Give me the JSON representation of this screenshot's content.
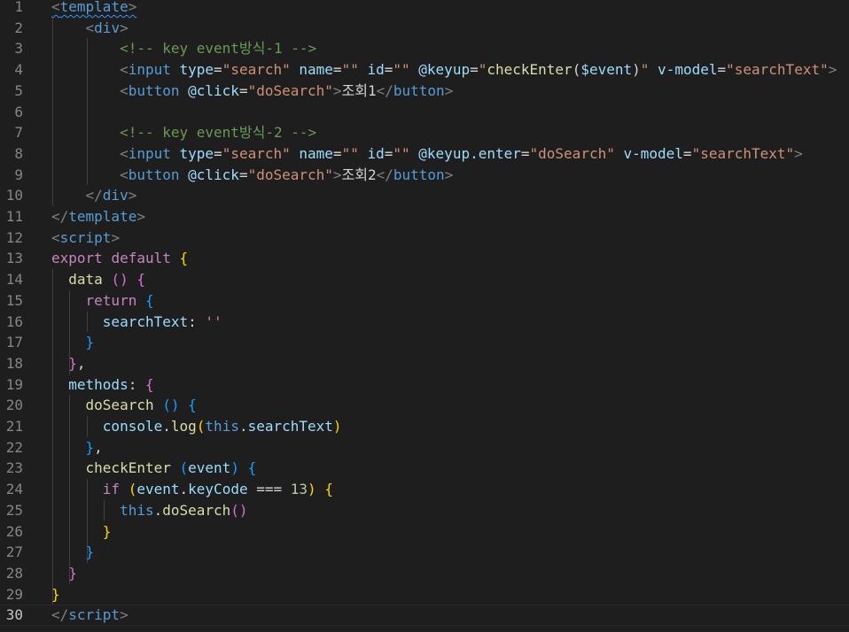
{
  "colors": {
    "background": "#1e1e1e",
    "line_number": "#858585",
    "line_number_active": "#c6c6c6",
    "tag_bracket": "#808080",
    "tag": "#569cd6",
    "attribute": "#9cdcfe",
    "string": "#ce9178",
    "comment": "#6a9955",
    "keyword_control": "#c586c0",
    "keyword": "#569cd6",
    "function": "#dcdcaa",
    "property": "#9cdcfe",
    "number": "#b5cea8",
    "plain": "#d4d4d4",
    "bracket_gold": "#ffd700",
    "bracket_purple": "#da70d6",
    "bracket_blue": "#179fff"
  },
  "editor": {
    "active_line": 30,
    "lines": [
      {
        "number": "1",
        "tokens": [
          {
            "t": "<",
            "c": "tag_bracket",
            "sq": true
          },
          {
            "t": "template",
            "c": "tag",
            "sq": true
          },
          {
            "t": ">",
            "c": "tag_bracket",
            "sq": true
          }
        ]
      },
      {
        "number": "2",
        "tokens": [
          {
            "t": "    ",
            "c": "plain"
          },
          {
            "t": "<",
            "c": "tag_bracket"
          },
          {
            "t": "div",
            "c": "tag"
          },
          {
            "t": ">",
            "c": "tag_bracket"
          }
        ]
      },
      {
        "number": "3",
        "tokens": [
          {
            "t": "        ",
            "c": "plain"
          },
          {
            "t": "<!-- key event방식-1 -->",
            "c": "comment"
          }
        ]
      },
      {
        "number": "4",
        "tokens": [
          {
            "t": "        ",
            "c": "plain"
          },
          {
            "t": "<",
            "c": "tag_bracket"
          },
          {
            "t": "input",
            "c": "tag"
          },
          {
            "t": " ",
            "c": "plain"
          },
          {
            "t": "type",
            "c": "attribute"
          },
          {
            "t": "=",
            "c": "plain"
          },
          {
            "t": "\"search\"",
            "c": "string"
          },
          {
            "t": " ",
            "c": "plain"
          },
          {
            "t": "name",
            "c": "attribute"
          },
          {
            "t": "=",
            "c": "plain"
          },
          {
            "t": "\"\"",
            "c": "string"
          },
          {
            "t": " ",
            "c": "plain"
          },
          {
            "t": "id",
            "c": "attribute"
          },
          {
            "t": "=",
            "c": "plain"
          },
          {
            "t": "\"\"",
            "c": "string"
          },
          {
            "t": " ",
            "c": "plain"
          },
          {
            "t": "@keyup",
            "c": "attribute"
          },
          {
            "t": "=",
            "c": "plain"
          },
          {
            "t": "\"",
            "c": "string"
          },
          {
            "t": "checkEnter",
            "c": "function"
          },
          {
            "t": "(",
            "c": "plain"
          },
          {
            "t": "$event",
            "c": "property"
          },
          {
            "t": ")",
            "c": "plain"
          },
          {
            "t": "\"",
            "c": "string"
          },
          {
            "t": " ",
            "c": "plain"
          },
          {
            "t": "v-model",
            "c": "attribute"
          },
          {
            "t": "=",
            "c": "plain"
          },
          {
            "t": "\"searchText\"",
            "c": "string"
          },
          {
            "t": ">",
            "c": "tag_bracket"
          }
        ]
      },
      {
        "number": "5",
        "tokens": [
          {
            "t": "        ",
            "c": "plain"
          },
          {
            "t": "<",
            "c": "tag_bracket"
          },
          {
            "t": "button",
            "c": "tag"
          },
          {
            "t": " ",
            "c": "plain"
          },
          {
            "t": "@click",
            "c": "attribute"
          },
          {
            "t": "=",
            "c": "plain"
          },
          {
            "t": "\"doSearch\"",
            "c": "string"
          },
          {
            "t": ">",
            "c": "tag_bracket"
          },
          {
            "t": "조회1",
            "c": "plain"
          },
          {
            "t": "</",
            "c": "tag_bracket"
          },
          {
            "t": "button",
            "c": "tag"
          },
          {
            "t": ">",
            "c": "tag_bracket"
          }
        ]
      },
      {
        "number": "6",
        "tokens": []
      },
      {
        "number": "7",
        "tokens": [
          {
            "t": "        ",
            "c": "plain"
          },
          {
            "t": "<!-- key event방식-2 -->",
            "c": "comment"
          }
        ]
      },
      {
        "number": "8",
        "tokens": [
          {
            "t": "        ",
            "c": "plain"
          },
          {
            "t": "<",
            "c": "tag_bracket"
          },
          {
            "t": "input",
            "c": "tag"
          },
          {
            "t": " ",
            "c": "plain"
          },
          {
            "t": "type",
            "c": "attribute"
          },
          {
            "t": "=",
            "c": "plain"
          },
          {
            "t": "\"search\"",
            "c": "string"
          },
          {
            "t": " ",
            "c": "plain"
          },
          {
            "t": "name",
            "c": "attribute"
          },
          {
            "t": "=",
            "c": "plain"
          },
          {
            "t": "\"\"",
            "c": "string"
          },
          {
            "t": " ",
            "c": "plain"
          },
          {
            "t": "id",
            "c": "attribute"
          },
          {
            "t": "=",
            "c": "plain"
          },
          {
            "t": "\"\"",
            "c": "string"
          },
          {
            "t": " ",
            "c": "plain"
          },
          {
            "t": "@keyup.enter",
            "c": "attribute"
          },
          {
            "t": "=",
            "c": "plain"
          },
          {
            "t": "\"doSearch\"",
            "c": "string"
          },
          {
            "t": " ",
            "c": "plain"
          },
          {
            "t": "v-model",
            "c": "attribute"
          },
          {
            "t": "=",
            "c": "plain"
          },
          {
            "t": "\"searchText\"",
            "c": "string"
          },
          {
            "t": ">",
            "c": "tag_bracket"
          }
        ]
      },
      {
        "number": "9",
        "tokens": [
          {
            "t": "        ",
            "c": "plain"
          },
          {
            "t": "<",
            "c": "tag_bracket"
          },
          {
            "t": "button",
            "c": "tag"
          },
          {
            "t": " ",
            "c": "plain"
          },
          {
            "t": "@click",
            "c": "attribute"
          },
          {
            "t": "=",
            "c": "plain"
          },
          {
            "t": "\"doSearch\"",
            "c": "string"
          },
          {
            "t": ">",
            "c": "tag_bracket"
          },
          {
            "t": "조회2",
            "c": "plain"
          },
          {
            "t": "</",
            "c": "tag_bracket"
          },
          {
            "t": "button",
            "c": "tag"
          },
          {
            "t": ">",
            "c": "tag_bracket"
          }
        ]
      },
      {
        "number": "10",
        "tokens": [
          {
            "t": "    ",
            "c": "plain"
          },
          {
            "t": "</",
            "c": "tag_bracket"
          },
          {
            "t": "div",
            "c": "tag"
          },
          {
            "t": ">",
            "c": "tag_bracket"
          }
        ]
      },
      {
        "number": "11",
        "tokens": [
          {
            "t": "</",
            "c": "tag_bracket"
          },
          {
            "t": "template",
            "c": "tag"
          },
          {
            "t": ">",
            "c": "tag_bracket"
          }
        ]
      },
      {
        "number": "12",
        "tokens": [
          {
            "t": "<",
            "c": "tag_bracket"
          },
          {
            "t": "script",
            "c": "tag"
          },
          {
            "t": ">",
            "c": "tag_bracket"
          }
        ]
      },
      {
        "number": "13",
        "tokens": [
          {
            "t": "export",
            "c": "keyword_control"
          },
          {
            "t": " ",
            "c": "plain"
          },
          {
            "t": "default",
            "c": "keyword_control"
          },
          {
            "t": " ",
            "c": "plain"
          },
          {
            "t": "{",
            "c": "bracket_gold"
          }
        ]
      },
      {
        "number": "14",
        "tokens": [
          {
            "t": "  ",
            "c": "plain"
          },
          {
            "t": "data",
            "c": "function"
          },
          {
            "t": " ",
            "c": "plain"
          },
          {
            "t": "()",
            "c": "bracket_purple"
          },
          {
            "t": " ",
            "c": "plain"
          },
          {
            "t": "{",
            "c": "bracket_purple"
          }
        ]
      },
      {
        "number": "15",
        "tokens": [
          {
            "t": "    ",
            "c": "plain"
          },
          {
            "t": "return",
            "c": "keyword_control"
          },
          {
            "t": " ",
            "c": "plain"
          },
          {
            "t": "{",
            "c": "bracket_blue"
          }
        ]
      },
      {
        "number": "16",
        "tokens": [
          {
            "t": "      ",
            "c": "plain"
          },
          {
            "t": "searchText",
            "c": "property"
          },
          {
            "t": ": ",
            "c": "plain"
          },
          {
            "t": "''",
            "c": "string"
          }
        ]
      },
      {
        "number": "17",
        "tokens": [
          {
            "t": "    ",
            "c": "plain"
          },
          {
            "t": "}",
            "c": "bracket_blue"
          }
        ]
      },
      {
        "number": "18",
        "tokens": [
          {
            "t": "  ",
            "c": "plain"
          },
          {
            "t": "}",
            "c": "bracket_purple"
          },
          {
            "t": ",",
            "c": "plain"
          }
        ]
      },
      {
        "number": "19",
        "tokens": [
          {
            "t": "  ",
            "c": "plain"
          },
          {
            "t": "methods",
            "c": "property"
          },
          {
            "t": ": ",
            "c": "plain"
          },
          {
            "t": "{",
            "c": "bracket_purple"
          }
        ]
      },
      {
        "number": "20",
        "tokens": [
          {
            "t": "    ",
            "c": "plain"
          },
          {
            "t": "doSearch",
            "c": "function"
          },
          {
            "t": " ",
            "c": "plain"
          },
          {
            "t": "()",
            "c": "bracket_blue"
          },
          {
            "t": " ",
            "c": "plain"
          },
          {
            "t": "{",
            "c": "bracket_blue"
          }
        ]
      },
      {
        "number": "21",
        "tokens": [
          {
            "t": "      ",
            "c": "plain"
          },
          {
            "t": "console",
            "c": "property"
          },
          {
            "t": ".",
            "c": "plain"
          },
          {
            "t": "log",
            "c": "function"
          },
          {
            "t": "(",
            "c": "bracket_gold"
          },
          {
            "t": "this",
            "c": "keyword"
          },
          {
            "t": ".",
            "c": "plain"
          },
          {
            "t": "searchText",
            "c": "property"
          },
          {
            "t": ")",
            "c": "bracket_gold"
          }
        ]
      },
      {
        "number": "22",
        "tokens": [
          {
            "t": "    ",
            "c": "plain"
          },
          {
            "t": "}",
            "c": "bracket_blue"
          },
          {
            "t": ",",
            "c": "plain"
          }
        ]
      },
      {
        "number": "23",
        "tokens": [
          {
            "t": "    ",
            "c": "plain"
          },
          {
            "t": "checkEnter",
            "c": "function"
          },
          {
            "t": " ",
            "c": "plain"
          },
          {
            "t": "(",
            "c": "bracket_blue"
          },
          {
            "t": "event",
            "c": "property"
          },
          {
            "t": ")",
            "c": "bracket_blue"
          },
          {
            "t": " ",
            "c": "plain"
          },
          {
            "t": "{",
            "c": "bracket_blue"
          }
        ]
      },
      {
        "number": "24",
        "tokens": [
          {
            "t": "      ",
            "c": "plain"
          },
          {
            "t": "if",
            "c": "keyword_control"
          },
          {
            "t": " ",
            "c": "plain"
          },
          {
            "t": "(",
            "c": "bracket_gold"
          },
          {
            "t": "event",
            "c": "property"
          },
          {
            "t": ".",
            "c": "plain"
          },
          {
            "t": "keyCode",
            "c": "property"
          },
          {
            "t": " === ",
            "c": "plain"
          },
          {
            "t": "13",
            "c": "number"
          },
          {
            "t": ")",
            "c": "bracket_gold"
          },
          {
            "t": " ",
            "c": "plain"
          },
          {
            "t": "{",
            "c": "bracket_gold"
          }
        ]
      },
      {
        "number": "25",
        "tokens": [
          {
            "t": "        ",
            "c": "plain"
          },
          {
            "t": "this",
            "c": "keyword"
          },
          {
            "t": ".",
            "c": "plain"
          },
          {
            "t": "doSearch",
            "c": "function"
          },
          {
            "t": "()",
            "c": "bracket_purple"
          }
        ]
      },
      {
        "number": "26",
        "tokens": [
          {
            "t": "      ",
            "c": "plain"
          },
          {
            "t": "}",
            "c": "bracket_gold"
          }
        ]
      },
      {
        "number": "27",
        "tokens": [
          {
            "t": "    ",
            "c": "plain"
          },
          {
            "t": "}",
            "c": "bracket_blue"
          }
        ]
      },
      {
        "number": "28",
        "tokens": [
          {
            "t": "  ",
            "c": "plain"
          },
          {
            "t": "}",
            "c": "bracket_purple"
          }
        ]
      },
      {
        "number": "29",
        "tokens": [
          {
            "t": "}",
            "c": "bracket_gold"
          }
        ]
      },
      {
        "number": "30",
        "tokens": [
          {
            "t": "</",
            "c": "tag_bracket"
          },
          {
            "t": "script",
            "c": "tag"
          },
          {
            "t": ">",
            "c": "tag_bracket"
          }
        ]
      }
    ]
  }
}
